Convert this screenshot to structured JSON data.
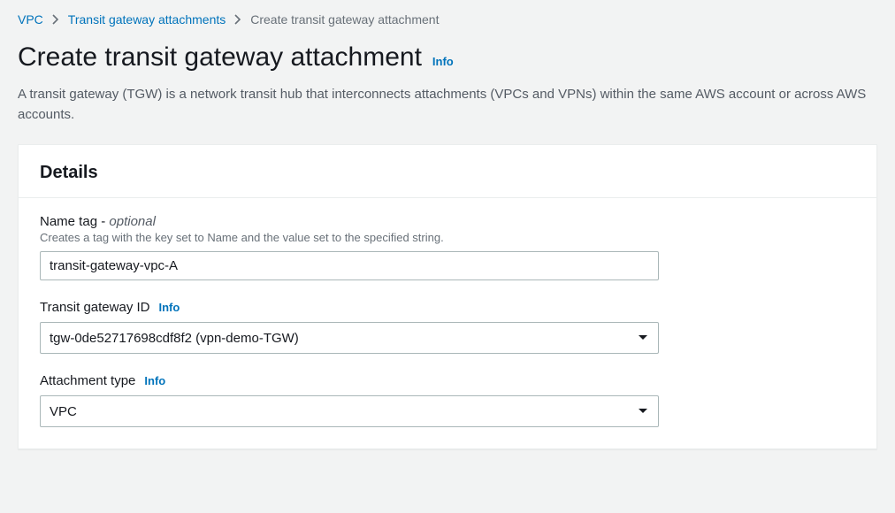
{
  "breadcrumb": {
    "items": [
      {
        "label": "VPC"
      },
      {
        "label": "Transit gateway attachments"
      },
      {
        "label": "Create transit gateway attachment"
      }
    ]
  },
  "page": {
    "title": "Create transit gateway attachment",
    "info": "Info",
    "description": "A transit gateway (TGW) is a network transit hub that interconnects attachments (VPCs and VPNs) within the same AWS account or across AWS accounts."
  },
  "panel": {
    "details_heading": "Details",
    "name_tag": {
      "label": "Name tag",
      "optional_suffix": " - ",
      "optional_word": "optional",
      "description": "Creates a tag with the key set to Name and the value set to the specified string.",
      "value": "transit-gateway-vpc-A"
    },
    "tgw_id": {
      "label": "Transit gateway ID",
      "info": "Info",
      "value": "tgw-0de52717698cdf8f2 (vpn-demo-TGW)"
    },
    "attach_type": {
      "label": "Attachment type",
      "info": "Info",
      "value": "VPC"
    }
  }
}
